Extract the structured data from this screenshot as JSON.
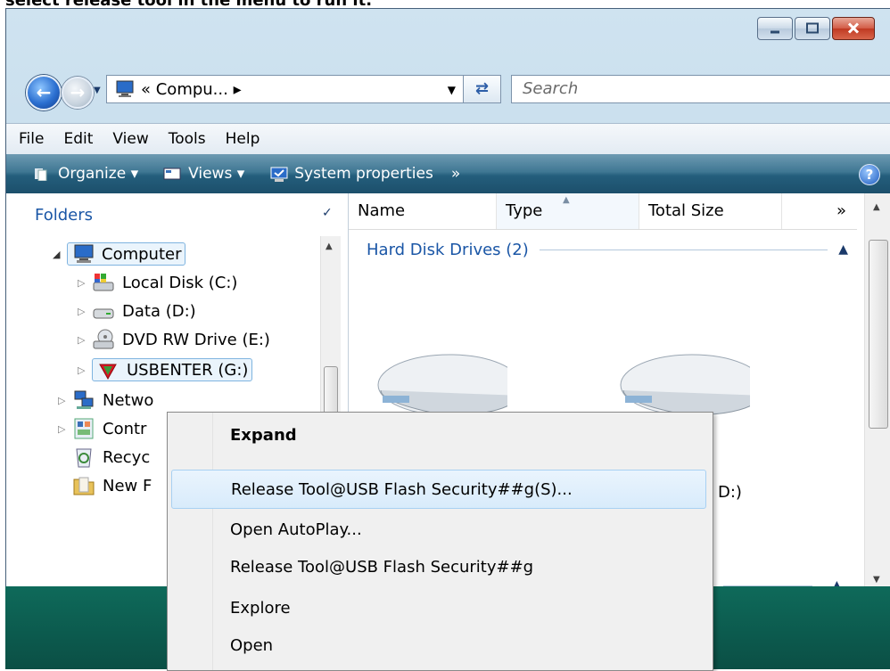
{
  "caption": "select release tool in the menu to run it.",
  "window": {
    "caption_buttons": [
      "minimize",
      "maximize",
      "close"
    ]
  },
  "address_bar": {
    "path": "« Compu... ▸",
    "search_placeholder": "Search"
  },
  "menubar": [
    "File",
    "Edit",
    "View",
    "Tools",
    "Help"
  ],
  "command_bar": {
    "organize": "Organize ▾",
    "views": "Views ▾",
    "system_properties": "System properties",
    "overflow": "»",
    "help": "?"
  },
  "nav": {
    "header": "Folders",
    "tree": [
      {
        "label": "Computer",
        "icon": "computer-icon"
      },
      {
        "label": "Local Disk (C:)",
        "icon": "local-disk-icon"
      },
      {
        "label": "Data (D:)",
        "icon": "drive-icon"
      },
      {
        "label": "DVD RW Drive (E:)",
        "icon": "dvd-drive-icon"
      },
      {
        "label": "USBENTER (G:)",
        "icon": "usb-drive-icon"
      },
      {
        "label": "Netwo",
        "icon": "network-icon"
      },
      {
        "label": "Contr",
        "icon": "control-panel-icon"
      },
      {
        "label": "Recyc",
        "icon": "recycle-bin-icon"
      },
      {
        "label": "New F",
        "icon": "folder-icon"
      }
    ]
  },
  "content": {
    "columns": [
      "Name",
      "Type",
      "Total Size",
      "»"
    ],
    "group": "Hard Disk Drives (2)",
    "partial_label": "D:)"
  },
  "context_menu": {
    "items": [
      {
        "label": "Expand",
        "bold": true
      },
      {
        "label": "Release Tool@USB Flash Security##g(S)...",
        "highlighted": true
      },
      {
        "label": "Open AutoPlay..."
      },
      {
        "label": "Release Tool@USB Flash Security##g"
      },
      {
        "label": "Explore"
      },
      {
        "label": "Open"
      }
    ]
  },
  "colors": {
    "accent_blue": "#1a56a6",
    "command_bar": "#245e7c",
    "desktop": "#0e6a5a",
    "menu_highlight": "#d8ebfb"
  }
}
